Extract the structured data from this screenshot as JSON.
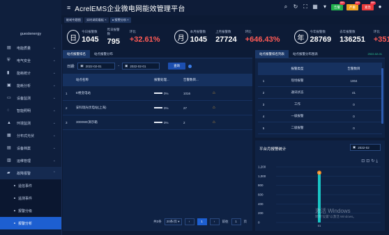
{
  "sidebar": {
    "user": "guestenergy",
    "items": [
      {
        "label": "电能质量",
        "icon": "bars-icon"
      },
      {
        "label": "电气安全",
        "icon": "shield-icon"
      },
      {
        "label": "能耗统计",
        "icon": "chart-icon"
      },
      {
        "label": "能耗分析",
        "icon": "doc-icon"
      },
      {
        "label": "设备监测",
        "icon": "monitor-icon"
      },
      {
        "label": "智能照明",
        "icon": "bulb-icon"
      },
      {
        "label": "环境监测",
        "icon": "thermo-icon"
      },
      {
        "label": "分布式光伏",
        "icon": "solar-icon"
      },
      {
        "label": "设备档案",
        "icon": "archive-icon"
      },
      {
        "label": "运维管理",
        "icon": "wrench-icon"
      },
      {
        "label": "故障报警",
        "icon": "alarm-icon"
      }
    ],
    "subitems": [
      "遥信事件",
      "遥测事件",
      "报警分级",
      "报警分析"
    ]
  },
  "topbar": {
    "title": "AcrelEMS企业微电网能效管理平台",
    "badges": [
      {
        "label": "告警",
        "count": "99+",
        "color": "#22b14c"
      },
      {
        "label": "严重",
        "count": "99+",
        "color": "#f0a020"
      },
      {
        "label": "紧急",
        "count": "99+",
        "color": "#e83a3a"
      }
    ]
  },
  "tabs": [
    "能耗专题图",
    "实时调用看板 ×",
    "● 报警分析 ×"
  ],
  "stats": {
    "day_icon": "日",
    "today_label": "今日报警数",
    "today_value": "1045",
    "yesterday_label": "昨日报警数",
    "yesterday_value": "795",
    "day_ratio_label": "环比",
    "day_ratio_value": "+32.61%",
    "month_icon": "月",
    "this_month_label": "本月报警数",
    "this_month_value": "1045",
    "last_month_label": "上月报警数",
    "last_month_value": "27724",
    "month_ratio_label": "环比",
    "month_ratio_value": "+646.43%",
    "year_icon": "年",
    "this_year_label": "今年报警数",
    "this_year_value": "28769",
    "last_year_label": "去年报警数",
    "last_year_value": "136251",
    "year_ratio_label": "环比",
    "year_ratio_value": "+351.92"
  },
  "left_panel": {
    "tabs": [
      "站点报警排名",
      "站点报警分布"
    ],
    "date_label": "日期:",
    "start_date": "2022-02-01",
    "end_date": "2022-02-01",
    "query_label": "查询",
    "columns": [
      "站点名称",
      "报警处理...",
      "告警数目..."
    ],
    "rows": [
      {
        "idx": "1",
        "name": "E楼变电站",
        "rate": "0%",
        "count": "1016"
      },
      {
        "idx": "2",
        "name": "安科瑞光伏电站(上海)",
        "rate": "0%",
        "count": "27"
      },
      {
        "idx": "3",
        "name": "3000WE演示箱",
        "rate": "0%",
        "count": "2"
      }
    ],
    "pager": {
      "total": "共3条",
      "per_page": "20条/页",
      "page": "1",
      "goto": "前往",
      "goto_page": "1",
      "page_unit": "页"
    }
  },
  "right_top": {
    "tabs": [
      "站点报警排名列表",
      "站点报警分布图表"
    ],
    "date": "2022-02-01",
    "columns": [
      "报警类型",
      "告警数目"
    ],
    "rows": [
      {
        "idx": "1",
        "type": "现场报警",
        "count": "1004"
      },
      {
        "idx": "2",
        "type": "通讯状态",
        "count": "41"
      },
      {
        "idx": "3",
        "type": "工作",
        "count": "0"
      },
      {
        "idx": "4",
        "type": "一级报警",
        "count": "0"
      },
      {
        "idx": "5",
        "type": "二级报警",
        "count": "0"
      }
    ]
  },
  "right_bottom": {
    "title": "平台月报警统计",
    "month": "2022-02"
  },
  "chart_data": {
    "type": "bar",
    "title": "平台月报警统计",
    "categories": [
      "01"
    ],
    "values": [
      1045
    ],
    "ylim": [
      0,
      1200
    ],
    "yticks": [
      "1,200",
      "1,000",
      "800",
      "600",
      "400",
      "200",
      "0"
    ],
    "marker_label": "9",
    "accent": "#19c4c4"
  },
  "watermark": {
    "line1": "激活 Windows",
    "line2": "转到\"设置\"以激活 Windows。"
  }
}
